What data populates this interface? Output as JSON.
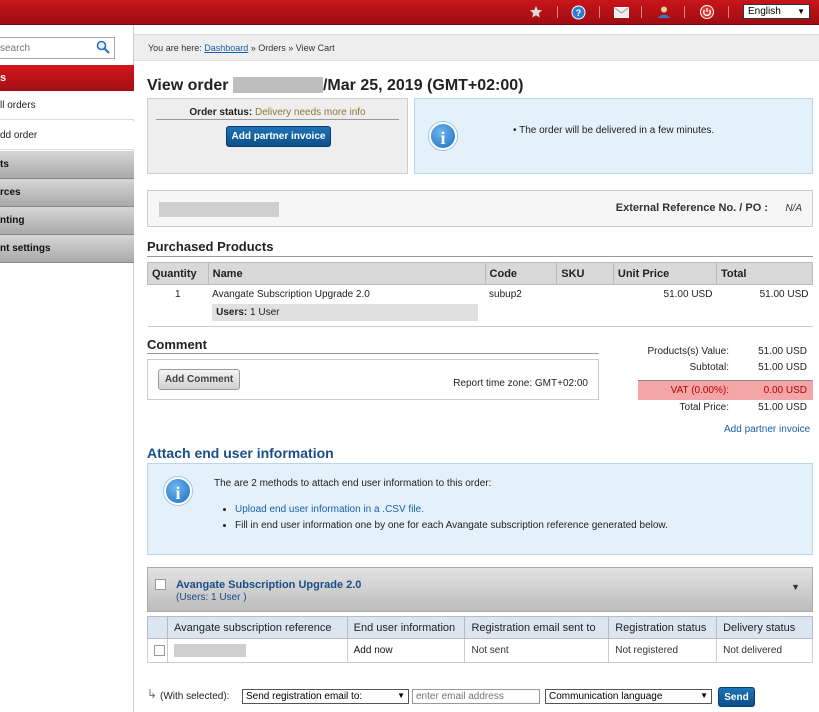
{
  "topbar": {
    "icons": [
      "star-icon",
      "help-icon",
      "mail-icon",
      "user-icon",
      "power-icon"
    ],
    "language": "English"
  },
  "sidebar": {
    "search_placeholder": "search",
    "active_section": "s",
    "items": [
      {
        "label": "ll orders"
      },
      {
        "label": "dd order"
      }
    ],
    "groups": [
      {
        "label": "ts"
      },
      {
        "label": "rces"
      },
      {
        "label": "nting"
      },
      {
        "label": "nt settings"
      }
    ]
  },
  "breadcrumb": {
    "prefix": "You are here:",
    "dashboard": "Dashboard",
    "rest": "» Orders » View Cart"
  },
  "order": {
    "title_prefix": "View order",
    "title_suffix": "/Mar 25, 2019 (GMT+02:00)",
    "status_label": "Order status:",
    "status_value": "Delivery needs more info",
    "add_partner_invoice": "Add partner invoice",
    "info_message": "The order will be delivered in a few minutes.",
    "ext_ref_label": "External Reference No. / PO :",
    "ext_ref_value": "N/A"
  },
  "products": {
    "title": "Purchased Products",
    "columns": [
      "Quantity",
      "Name",
      "Code",
      "SKU",
      "Unit Price",
      "Total"
    ],
    "rows": [
      {
        "quantity": "1",
        "name": "Avangate Subscription Upgrade 2.0",
        "users": "1 User",
        "users_label": "Users:",
        "code": "subup2",
        "sku": "",
        "unit_price": "51.00 USD",
        "total": "51.00 USD"
      }
    ]
  },
  "comment": {
    "title": "Comment",
    "add_button": "Add Comment",
    "timezone": "Report time zone: GMT+02:00"
  },
  "totals": {
    "products_value_label": "Products(s) Value:",
    "products_value": "51.00 USD",
    "subtotal_label": "Subtotal:",
    "subtotal": "51.00 USD",
    "vat_label": "VAT (0.00%):",
    "vat": "0.00 USD",
    "total_label": "Total Price:",
    "total": "51.00 USD",
    "partner_invoice_link": "Add partner invoice"
  },
  "attach": {
    "title": "Attach end user information",
    "intro": "The are 2 methods to attach end user information to this order:",
    "method_csv": "Upload end user information in a .CSV file.",
    "method_manual": "Fill in end user information one by one for each Avangate subscription reference generated below."
  },
  "subscription": {
    "name": "Avangate Subscription Upgrade 2.0",
    "users": "(Users: 1 User   )",
    "columns": [
      "Avangate subscription reference",
      "End user information",
      "Registration email sent to",
      "Registration status",
      "Delivery status"
    ],
    "rows": [
      {
        "end_user": "Add now",
        "email_sent": "Not sent",
        "reg_status": "Not registered",
        "delivery": "Not delivered"
      }
    ]
  },
  "bulk": {
    "with_selected": "(With selected):",
    "action": "Send registration email to:",
    "email_placeholder": "enter email address",
    "language": "Communication language",
    "send": "Send"
  },
  "colors": {
    "brand_red": "#b3121a",
    "accent_blue": "#1a5fa8",
    "vat_highlight": "#f2a6a8"
  }
}
